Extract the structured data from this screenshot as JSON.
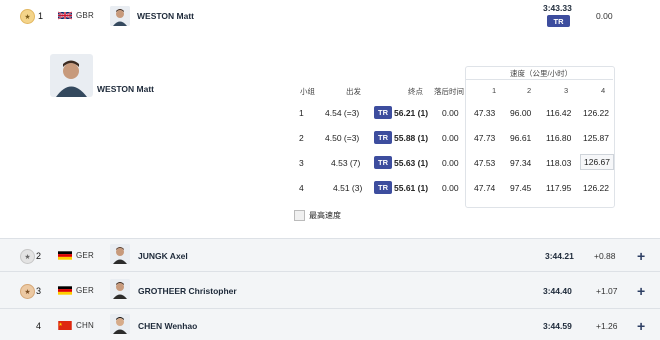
{
  "leader": {
    "rank": "1",
    "noc": "GBR",
    "name": "WESTON Matt",
    "time": "3:43.33",
    "badge": "TR",
    "diff": "0.00"
  },
  "detail": {
    "athlete_name": "WESTON Matt",
    "headers": {
      "run": "小组",
      "start": "出发",
      "finish": "终点",
      "behind": "落后时间",
      "speed_group": "速度（公里/小时）",
      "s1": "1",
      "s2": "2",
      "s3": "3",
      "s4": "4"
    },
    "rows": [
      {
        "run": "1",
        "start": "4.54 (=3)",
        "badge": "TR",
        "finish": "56.21 (1)",
        "behind": "0.00",
        "s1": "47.33",
        "s2": "96.00",
        "s3": "116.42",
        "s4": "126.22"
      },
      {
        "run": "2",
        "start": "4.50 (=3)",
        "badge": "TR",
        "finish": "55.88 (1)",
        "behind": "0.00",
        "s1": "47.73",
        "s2": "96.61",
        "s3": "116.80",
        "s4": "125.87"
      },
      {
        "run": "3",
        "start": "4.53 (7)",
        "badge": "TR",
        "finish": "55.63 (1)",
        "behind": "0.00",
        "s1": "47.53",
        "s2": "97.34",
        "s3": "118.03",
        "s4": "126.67"
      },
      {
        "run": "4",
        "start": "4.51 (3)",
        "badge": "TR",
        "finish": "55.61 (1)",
        "behind": "0.00",
        "s1": "47.74",
        "s2": "97.45",
        "s3": "117.95",
        "s4": "126.22"
      }
    ],
    "legend": "最高速度"
  },
  "others": [
    {
      "rank": "2",
      "noc": "GER",
      "name": "JUNGK Axel",
      "time": "3:44.21",
      "diff": "+0.88",
      "medal": "silver"
    },
    {
      "rank": "3",
      "noc": "GER",
      "name": "GROTHEER Christopher",
      "time": "3:44.40",
      "diff": "+1.07",
      "medal": "bronze"
    },
    {
      "rank": "4",
      "noc": "CHN",
      "name": "CHEN Wenhao",
      "time": "3:44.59",
      "diff": "+1.26",
      "medal": "none"
    }
  ],
  "icons": {
    "expand": "plus-icon",
    "medal_gold": "medal-gold-icon",
    "medal_silver": "medal-silver-icon",
    "medal_bronze": "medal-bronze-icon"
  },
  "colors": {
    "badge": "#3d4d9e",
    "grey_row": "#f3f5f7",
    "text": "#1e2a3a"
  }
}
